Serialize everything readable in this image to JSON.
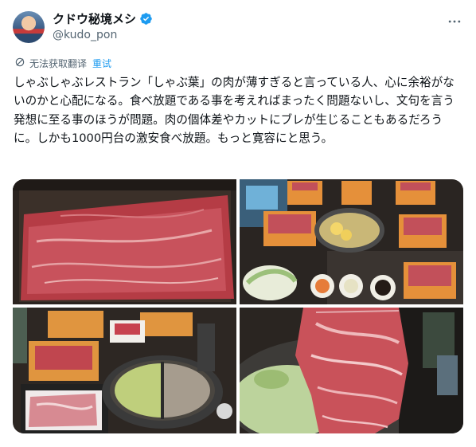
{
  "author": {
    "display_name": "クドウ秘境メシ",
    "handle": "@kudo_pon",
    "avatar_icon": "avatar-photo",
    "verified_icon": "verified-badge-icon"
  },
  "more_icon": "more-options-icon",
  "translation": {
    "status": "无法获取翻译",
    "retry": "重试",
    "icon": "translate-off-icon"
  },
  "tweet": {
    "text": "しゃぶしゃぶレストラン「しゃぶ葉」の肉が薄すぎると言っている人、心に余裕がないのかと心配になる。食べ放題である事を考えればまったく問題ないし、文句を言う発想に至る事のほうが問題。肉の個体差やカットにブレが生じることもあるだろうに。しかも1000円台の激安食べ放題。もっと寛容にと思う。"
  },
  "media": {
    "photos": [
      "thin-beef-slices-photo",
      "shabu-shabu-table-photo",
      "hot-pot-and-meat-trays-photo",
      "meat-lifted-from-broth-photo"
    ]
  },
  "colors": {
    "accent": "#1d9bf0",
    "text": "#0f1419",
    "secondary": "#536471"
  }
}
